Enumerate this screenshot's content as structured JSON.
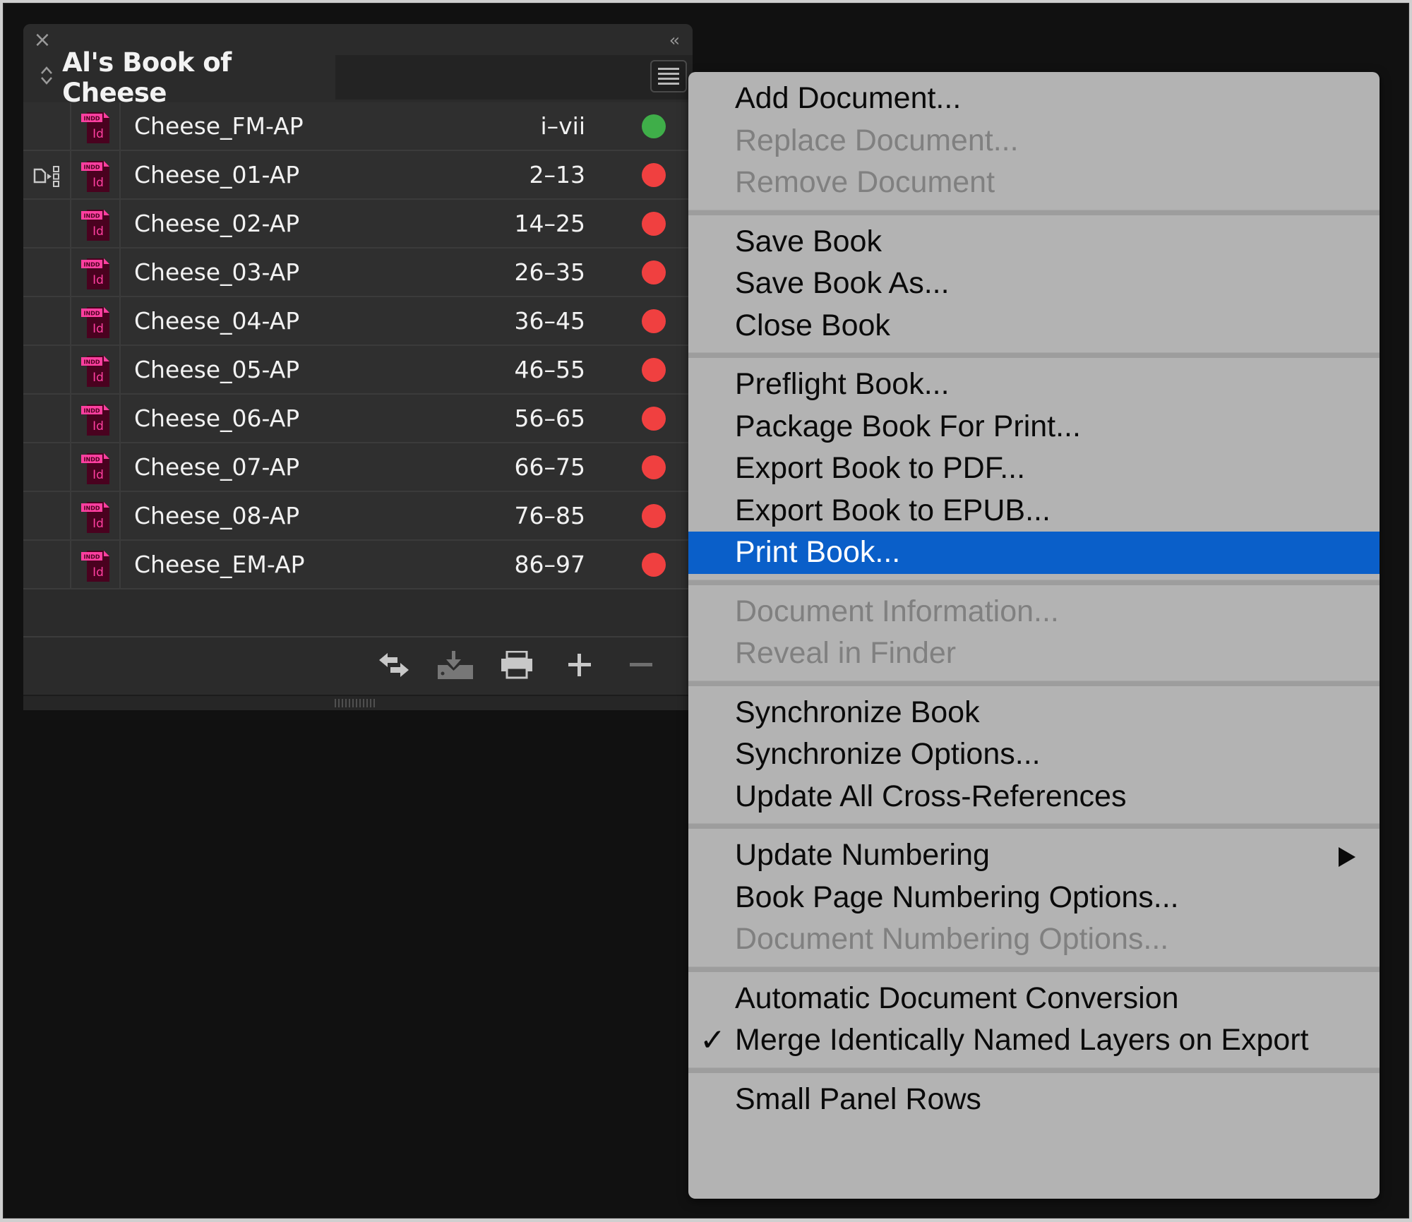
{
  "panel": {
    "close_label": "×",
    "collapse_label": "‹‹",
    "tab_arrows": "⬍",
    "book_title": "Al's Book of Cheese",
    "menu_button_icon": "hamburger-menu-icon",
    "documents": [
      {
        "name": "Cheese_FM-AP",
        "pages": "i–vii",
        "status": "ok",
        "sync_source": false
      },
      {
        "name": "Cheese_01-AP",
        "pages": "2–13",
        "status": "modified",
        "sync_source": true
      },
      {
        "name": "Cheese_02-AP",
        "pages": "14–25",
        "status": "modified",
        "sync_source": false
      },
      {
        "name": "Cheese_03-AP",
        "pages": "26–35",
        "status": "modified",
        "sync_source": false
      },
      {
        "name": "Cheese_04-AP",
        "pages": "36–45",
        "status": "modified",
        "sync_source": false
      },
      {
        "name": "Cheese_05-AP",
        "pages": "46–55",
        "status": "modified",
        "sync_source": false
      },
      {
        "name": "Cheese_06-AP",
        "pages": "56–65",
        "status": "modified",
        "sync_source": false
      },
      {
        "name": "Cheese_07-AP",
        "pages": "66–75",
        "status": "modified",
        "sync_source": false
      },
      {
        "name": "Cheese_08-AP",
        "pages": "76–85",
        "status": "modified",
        "sync_source": false
      },
      {
        "name": "Cheese_EM-AP",
        "pages": "86–97",
        "status": "modified",
        "sync_source": false
      }
    ],
    "doc_icon_label_top": "INDD",
    "doc_icon_label_main": "Id",
    "toolbar": [
      {
        "name": "synchronize-icon",
        "enabled": true
      },
      {
        "name": "save-book-icon",
        "enabled": false
      },
      {
        "name": "print-icon",
        "enabled": true
      },
      {
        "name": "add-document-icon",
        "enabled": true
      },
      {
        "name": "remove-document-icon",
        "enabled": false
      }
    ]
  },
  "colors": {
    "status_ok": "#3fae49",
    "status_modified": "#f04040",
    "highlight": "#0a5fc9",
    "indd_pink": "#ff3fa0",
    "indd_dark": "#49021f"
  },
  "menu": {
    "sections": [
      [
        {
          "label": "Add Document...",
          "enabled": true
        },
        {
          "label": "Replace Document...",
          "enabled": false
        },
        {
          "label": "Remove Document",
          "enabled": false
        }
      ],
      [
        {
          "label": "Save Book",
          "enabled": true
        },
        {
          "label": "Save Book As...",
          "enabled": true
        },
        {
          "label": "Close Book",
          "enabled": true
        }
      ],
      [
        {
          "label": "Preflight Book...",
          "enabled": true
        },
        {
          "label": "Package Book For Print...",
          "enabled": true
        },
        {
          "label": "Export Book to PDF...",
          "enabled": true
        },
        {
          "label": "Export Book to EPUB...",
          "enabled": true
        },
        {
          "label": "Print Book...",
          "enabled": true,
          "highlighted": true
        }
      ],
      [
        {
          "label": "Document Information...",
          "enabled": false
        },
        {
          "label": "Reveal in Finder",
          "enabled": false
        }
      ],
      [
        {
          "label": "Synchronize Book",
          "enabled": true
        },
        {
          "label": "Synchronize Options...",
          "enabled": true
        },
        {
          "label": "Update All Cross-References",
          "enabled": true
        }
      ],
      [
        {
          "label": "Update Numbering",
          "enabled": true,
          "submenu": true
        },
        {
          "label": "Book Page Numbering Options...",
          "enabled": true
        },
        {
          "label": "Document Numbering Options...",
          "enabled": false
        }
      ],
      [
        {
          "label": "Automatic Document Conversion",
          "enabled": true
        },
        {
          "label": "Merge Identically Named Layers on Export",
          "enabled": true,
          "checked": true
        }
      ],
      [
        {
          "label": "Small Panel Rows",
          "enabled": true
        }
      ]
    ],
    "check_glyph": "✓"
  }
}
